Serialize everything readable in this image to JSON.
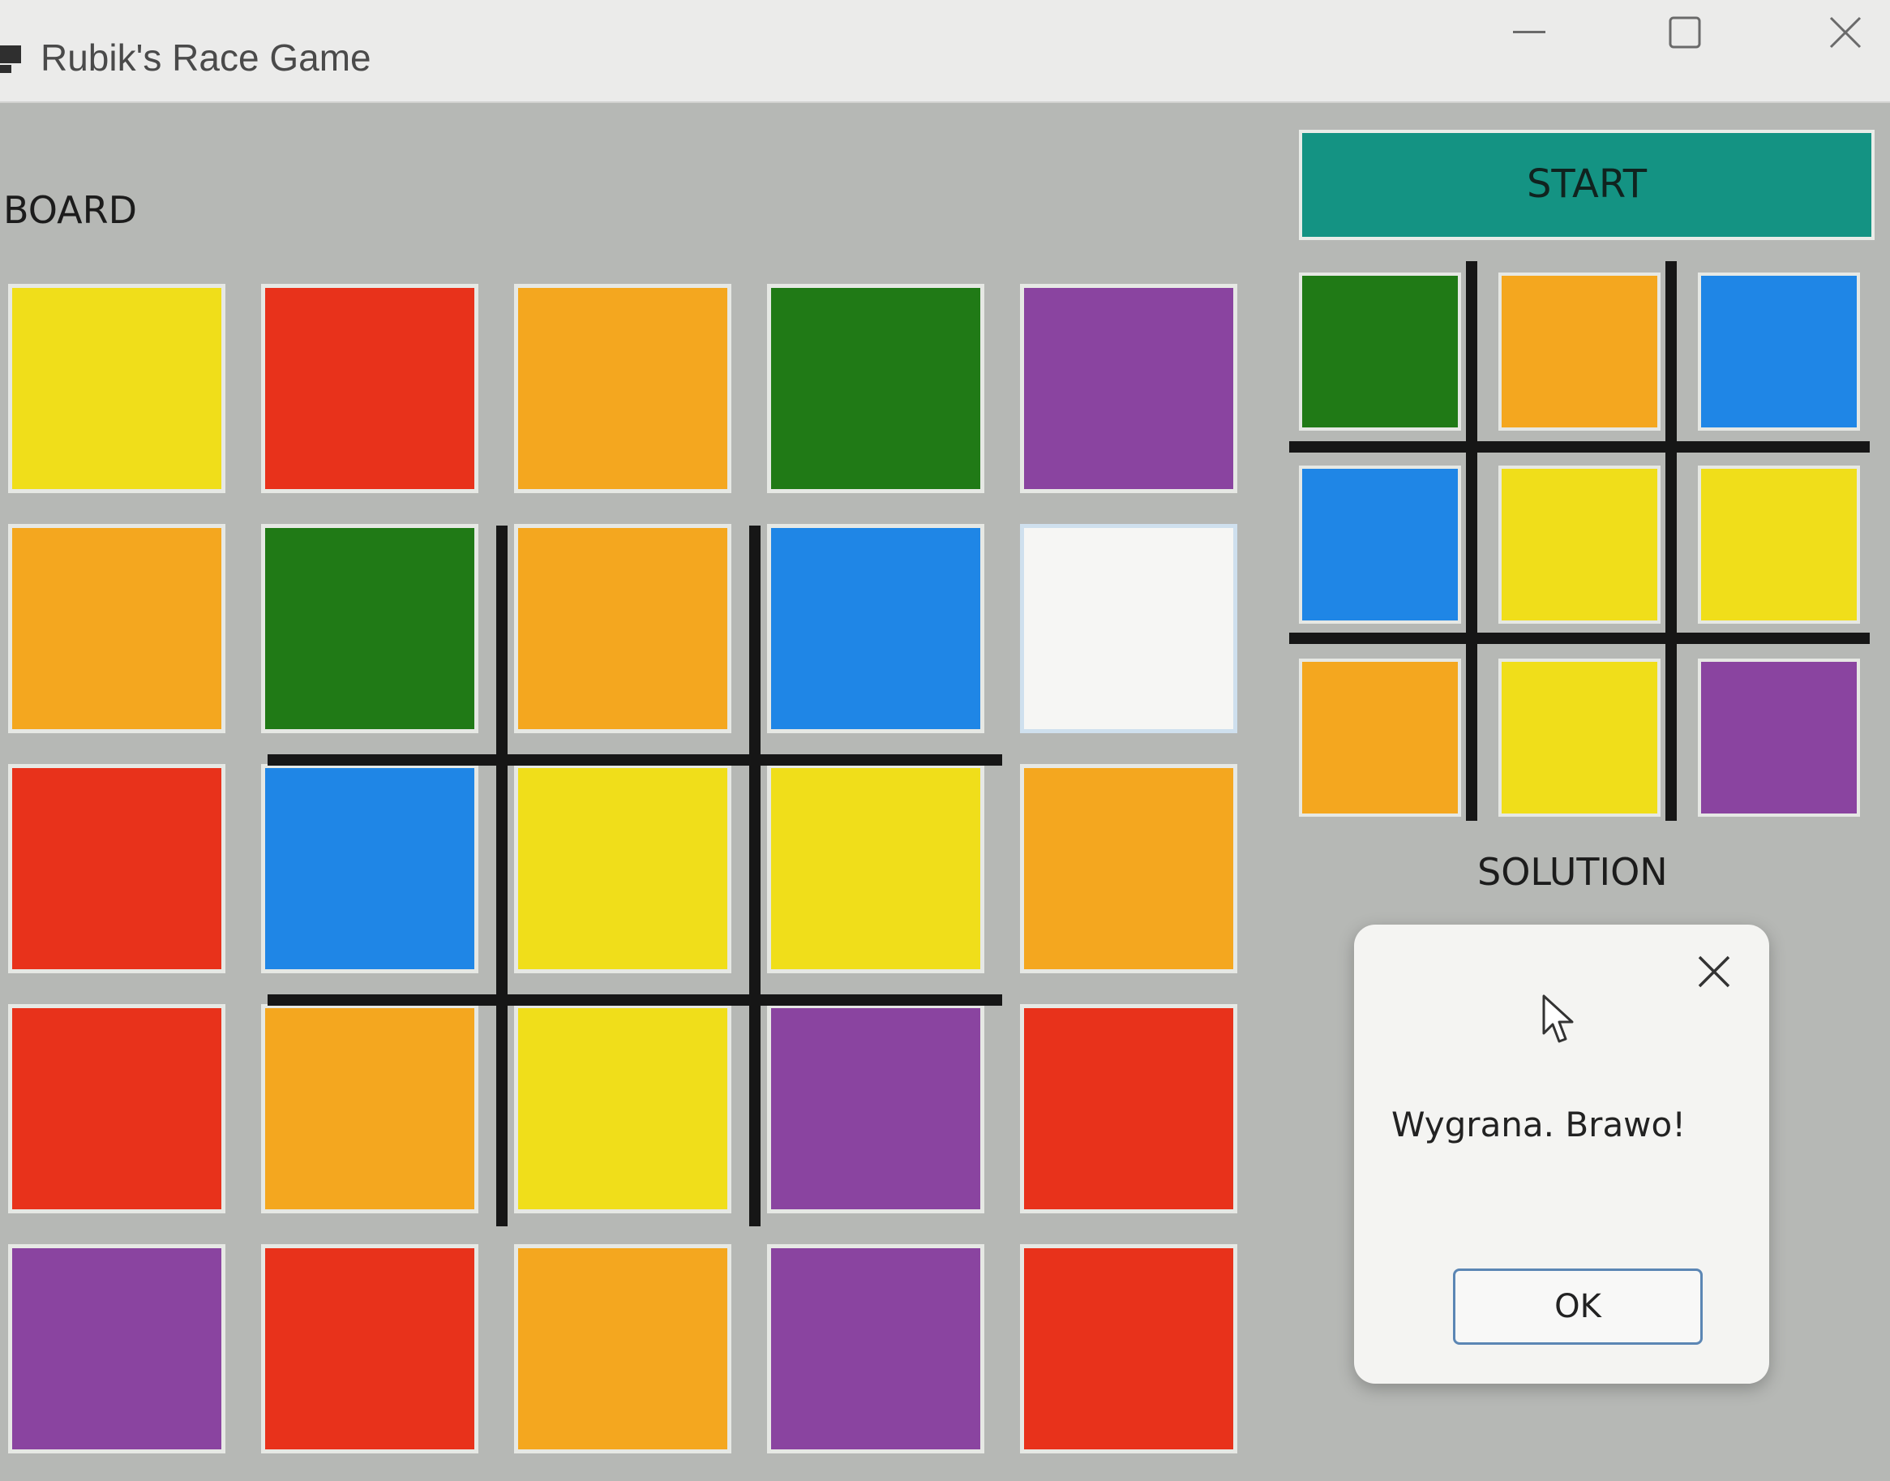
{
  "window": {
    "title": "Rubik's Race Game",
    "minimize_icon": "minimize-icon",
    "maximize_icon": "maximize-icon",
    "close_icon": "close-icon"
  },
  "labels": {
    "board": "BOARD",
    "solution": "SOLUTION"
  },
  "start_button": {
    "label": "START"
  },
  "colors": {
    "yellow": "#f0de1a",
    "red": "#e8321b",
    "orange": "#f4a71f",
    "green": "#207a16",
    "purple": "#8a44a0",
    "blue": "#1f86e6",
    "empty": "#f6f6f4",
    "start": "#149383"
  },
  "board": [
    [
      "yellow",
      "red",
      "orange",
      "green",
      "purple"
    ],
    [
      "orange",
      "green",
      "orange",
      "blue",
      "empty"
    ],
    [
      "red",
      "blue",
      "yellow",
      "yellow",
      "orange"
    ],
    [
      "red",
      "orange",
      "yellow",
      "purple",
      "red"
    ],
    [
      "purple",
      "red",
      "orange",
      "purple",
      "red"
    ]
  ],
  "solution": [
    [
      "green",
      "orange",
      "blue"
    ],
    [
      "blue",
      "yellow",
      "yellow"
    ],
    [
      "orange",
      "yellow",
      "purple"
    ]
  ],
  "dialog": {
    "message": "Wygrana. Brawo!",
    "ok_label": "OK",
    "close_icon": "close-icon"
  }
}
